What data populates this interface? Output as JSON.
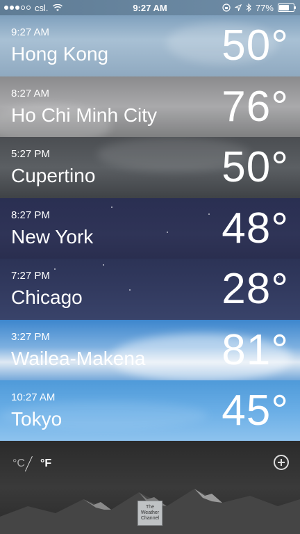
{
  "status_bar": {
    "carrier": "csl.",
    "time": "9:27 AM",
    "battery": "77%",
    "battery_level": 0.77,
    "icons": [
      "signal-dots-icon",
      "wifi-icon",
      "location-icon",
      "bluetooth-icon",
      "battery-icon",
      "lock-rotation-icon"
    ]
  },
  "cities": [
    {
      "time": "9:27 AM",
      "name": "Hong Kong",
      "temp": "50°"
    },
    {
      "time": "8:27 AM",
      "name": "Ho Chi Minh City",
      "temp": "76°"
    },
    {
      "time": "5:27 PM",
      "name": "Cupertino",
      "temp": "50°"
    },
    {
      "time": "8:27 PM",
      "name": "New York",
      "temp": "48°"
    },
    {
      "time": "7:27 PM",
      "name": "Chicago",
      "temp": "28°"
    },
    {
      "time": "3:27 PM",
      "name": "Wailea-Makena",
      "temp": "81°"
    },
    {
      "time": "10:27 AM",
      "name": "Tokyo",
      "temp": "45°"
    }
  ],
  "footer": {
    "unit_celsius": "°C",
    "unit_fahrenheit": "°F",
    "add_icon": "plus-circle-icon",
    "logo_lines": [
      "The",
      "Weather",
      "Channel"
    ]
  }
}
